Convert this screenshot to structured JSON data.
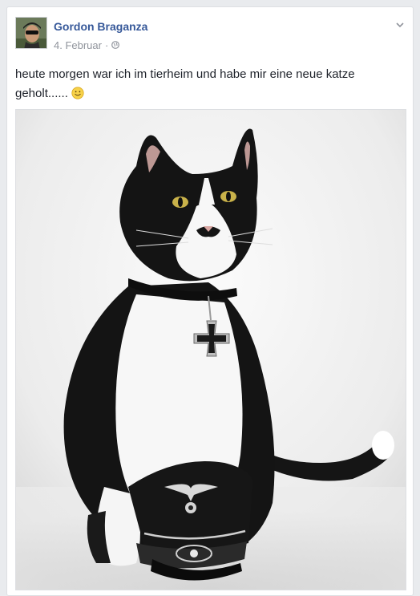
{
  "post": {
    "author": "Gordon Braganza",
    "date": "4. Februar",
    "separator": "·",
    "privacy_icon": "globe-icon",
    "menu_icon": "chevron-down-icon",
    "text": "heute morgen war ich im tierheim und habe mir eine neue katze geholt......",
    "emoji": "smiley-emoji"
  },
  "photo": {
    "alt": "Black-and-white cat wearing a collar with an iron cross pendant, sitting behind a black military cap"
  },
  "colors": {
    "author_link": "#365899",
    "meta_text": "#90949c",
    "body_text": "#1d2129",
    "background": "#e9ebee",
    "card": "#ffffff"
  }
}
